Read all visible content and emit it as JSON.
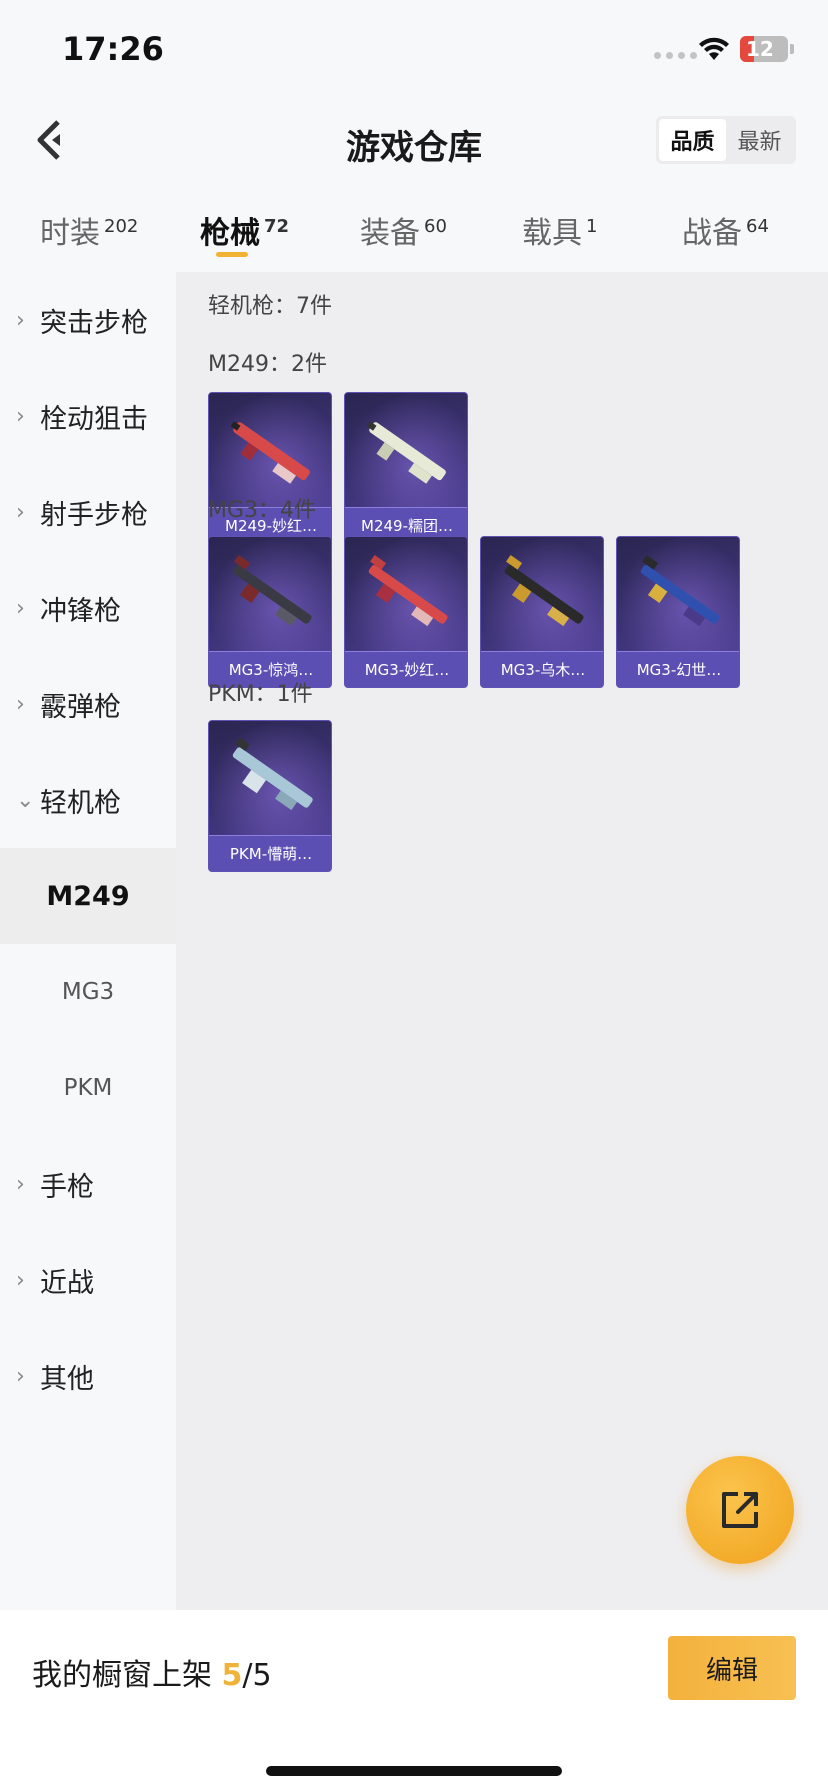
{
  "status": {
    "time": "17:26",
    "battery": "12"
  },
  "header": {
    "title": "游戏仓库",
    "sort": [
      "品质",
      "最新"
    ]
  },
  "tabs": [
    {
      "label": "时装",
      "count": "202"
    },
    {
      "label": "枪械",
      "count": "72"
    },
    {
      "label": "装备",
      "count": "60"
    },
    {
      "label": "载具",
      "count": "1"
    },
    {
      "label": "战备",
      "count": "64"
    }
  ],
  "sidebar": {
    "categories": [
      "突击步枪",
      "栓动狙击",
      "射手步枪",
      "冲锋枪",
      "霰弹枪",
      "轻机枪",
      "手枪",
      "近战",
      "其他"
    ],
    "subitems": [
      "M249",
      "MG3",
      "PKM"
    ]
  },
  "main": {
    "heading": "轻机枪：7件",
    "groups": [
      {
        "title": "M249：2件",
        "items": [
          "M249-妙红…",
          "M249-糯团…"
        ]
      },
      {
        "title": "MG3：4件",
        "items": [
          "MG3-惊鸿…",
          "MG3-妙红…",
          "MG3-乌木…",
          "MG3-幻世…"
        ]
      },
      {
        "title": "PKM：1件",
        "items": [
          "PKM-懵萌…"
        ]
      }
    ]
  },
  "bottom": {
    "prefix": "我的橱窗上架 ",
    "current": "5",
    "total": "/5",
    "edit": "编辑"
  },
  "colors": {
    "accent": "#f2b233",
    "card": "#3e3478"
  },
  "icons": [
    "back-arrow-icon",
    "wifi-icon",
    "battery-icon",
    "share-icon",
    "chevron-right-icon",
    "chevron-down-icon"
  ]
}
